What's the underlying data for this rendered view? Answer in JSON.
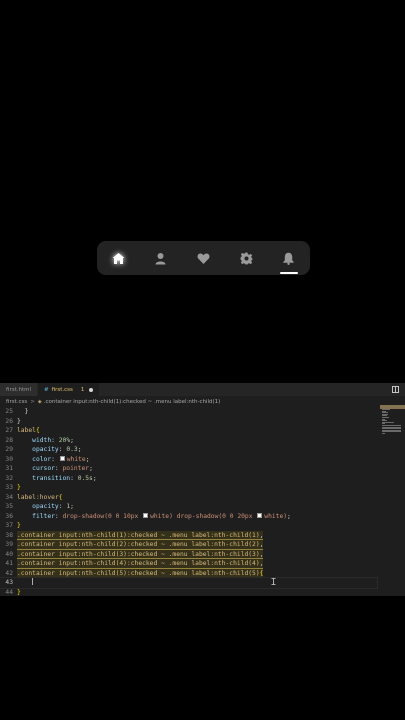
{
  "preview": {
    "menu": [
      {
        "icon": "home-icon",
        "active": true
      },
      {
        "icon": "user-icon",
        "active": false
      },
      {
        "icon": "heart-icon",
        "active": false
      },
      {
        "icon": "gear-icon",
        "active": false
      },
      {
        "icon": "bell-icon",
        "active": false
      }
    ],
    "colors": {
      "menu_bg": "#232323",
      "icon_inactive": "#9a9a9a",
      "icon_active": "#ffffff"
    }
  },
  "editor": {
    "tabs": [
      {
        "name": "first.html",
        "active": false
      },
      {
        "name": "first.css",
        "active": true,
        "problems": "1",
        "unsaved": true
      }
    ],
    "breadcrumb": {
      "file": "first.css",
      "separator": ">",
      "selector": ".container input:nth-child(1):checked ~ .menu label:nth-child(1)"
    },
    "lines": [
      {
        "n": "25",
        "parts": [
          [
            "p",
            "  }"
          ]
        ]
      },
      {
        "n": "26",
        "parts": [
          [
            "p",
            "}"
          ]
        ]
      },
      {
        "n": "27",
        "parts": [
          [
            "sel",
            "label"
          ],
          [
            "brace",
            "{"
          ]
        ]
      },
      {
        "n": "28",
        "parts": [
          [
            "p",
            "    "
          ],
          [
            "prop",
            "width"
          ],
          [
            "p",
            ": "
          ],
          [
            "num",
            "20%"
          ],
          [
            "p",
            ";"
          ]
        ]
      },
      {
        "n": "29",
        "parts": [
          [
            "p",
            "    "
          ],
          [
            "prop",
            "opacity"
          ],
          [
            "p",
            ": "
          ],
          [
            "num",
            "0.3"
          ],
          [
            "p",
            ";"
          ]
        ]
      },
      {
        "n": "30",
        "parts": [
          [
            "p",
            "    "
          ],
          [
            "prop",
            "color"
          ],
          [
            "p",
            ": "
          ],
          [
            "swatch",
            ""
          ],
          [
            "val",
            "white"
          ],
          [
            "p",
            ";"
          ]
        ]
      },
      {
        "n": "31",
        "parts": [
          [
            "p",
            "    "
          ],
          [
            "prop",
            "cursor"
          ],
          [
            "p",
            ": "
          ],
          [
            "val",
            "pointer"
          ],
          [
            "p",
            ";"
          ]
        ]
      },
      {
        "n": "32",
        "parts": [
          [
            "p",
            "    "
          ],
          [
            "prop",
            "transition"
          ],
          [
            "p",
            ": "
          ],
          [
            "num",
            "0.5s"
          ],
          [
            "p",
            ";"
          ]
        ]
      },
      {
        "n": "33",
        "parts": [
          [
            "brace",
            "}"
          ]
        ]
      },
      {
        "n": "34",
        "parts": [
          [
            "sel",
            "label:hover"
          ],
          [
            "brace",
            "{"
          ]
        ]
      },
      {
        "n": "35",
        "parts": [
          [
            "p",
            "    "
          ],
          [
            "prop",
            "opacity"
          ],
          [
            "p",
            ": "
          ],
          [
            "num",
            "1"
          ],
          [
            "p",
            ";"
          ]
        ]
      },
      {
        "n": "36",
        "parts": [
          [
            "p",
            "    "
          ],
          [
            "prop",
            "filter"
          ],
          [
            "p",
            ": "
          ],
          [
            "val",
            "drop-shadow(0 0 10px "
          ],
          [
            "swatch",
            ""
          ],
          [
            "val",
            "white) drop-shadow(0 0 20px "
          ],
          [
            "swatch",
            ""
          ],
          [
            "val",
            "white)"
          ],
          [
            "p",
            ";"
          ]
        ]
      },
      {
        "n": "37",
        "parts": [
          [
            "brace",
            "}"
          ]
        ]
      },
      {
        "n": "38",
        "hl": true,
        "parts": [
          [
            "sel",
            ".container input:nth-child(1):checked ~ .menu label:nth-child(1)"
          ],
          [
            "p",
            ","
          ]
        ]
      },
      {
        "n": "39",
        "hl": true,
        "parts": [
          [
            "sel",
            ".container input:nth-child(2):checked ~ .menu label:nth-child(2)"
          ],
          [
            "p",
            ","
          ]
        ]
      },
      {
        "n": "40",
        "hl": true,
        "parts": [
          [
            "sel",
            ".container input:nth-child(3):checked ~ .menu label:nth-child(3)"
          ],
          [
            "p",
            ","
          ]
        ]
      },
      {
        "n": "41",
        "hl": true,
        "parts": [
          [
            "sel",
            ".container input:nth-child(4):checked ~ .menu label:nth-child(4)"
          ],
          [
            "p",
            ","
          ]
        ]
      },
      {
        "n": "42",
        "hl": true,
        "parts": [
          [
            "sel",
            ".container input:nth-child(5):checked ~ .menu label:nth-child(5)"
          ],
          [
            "brace",
            "{"
          ]
        ]
      },
      {
        "n": "43",
        "cur": true,
        "parts": [
          [
            "p",
            "    "
          ]
        ]
      },
      {
        "n": "44",
        "parts": [
          [
            "brace",
            "}"
          ]
        ]
      }
    ],
    "colors": {
      "background": "#1e1e1e",
      "selector": "#d7ba7d",
      "property": "#9cdcfe",
      "number": "#b5cea8",
      "string": "#ce9178",
      "brace": "#ffd700"
    }
  }
}
